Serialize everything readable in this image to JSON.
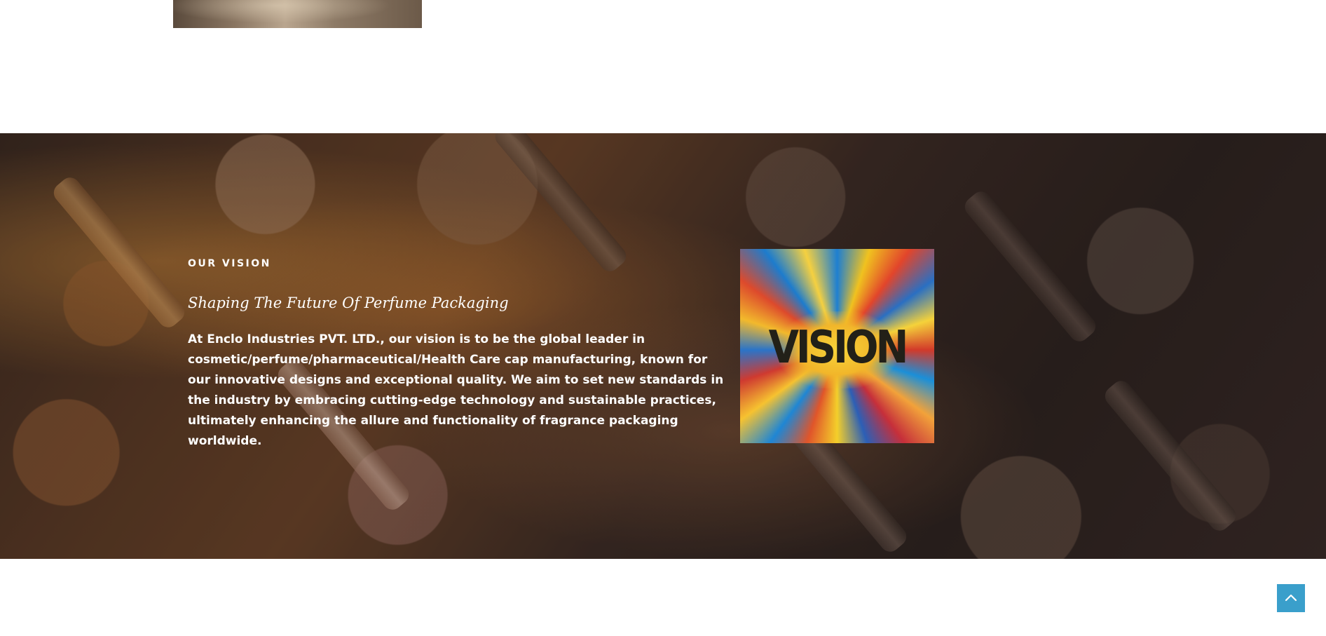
{
  "vision_section": {
    "eyebrow": "OUR VISION",
    "heading": "Shaping The Future Of Perfume Packaging",
    "body": "At Enclo Industries PVT. LTD., our vision is to be the global leader in cosmetic/perfume/pharmaceutical/Health Care cap manufacturing, known for our innovative designs and exceptional quality. We aim to set new standards in the industry by embracing cutting-edge technology and sustainable practices, ultimately enhancing the allure and functionality of fragrance packaging worldwide.",
    "image_text": "VISION"
  },
  "scroll_top": {
    "icon": "chevron-up-icon",
    "color": "#3a9fcb"
  }
}
